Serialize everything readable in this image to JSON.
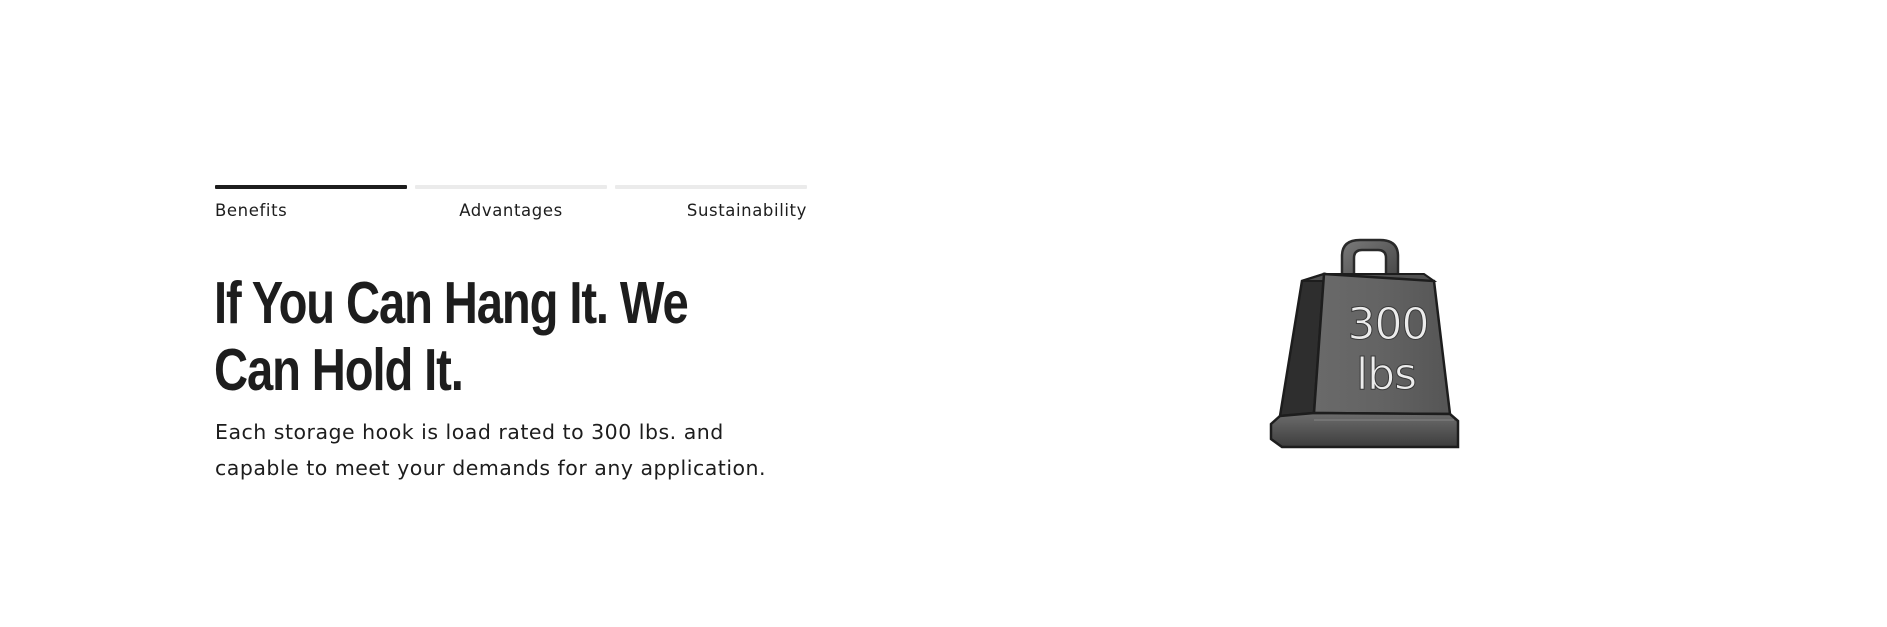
{
  "tabs": [
    {
      "label": "Benefits",
      "active": true
    },
    {
      "label": "Advantages",
      "active": false
    },
    {
      "label": "Sustainability",
      "active": false
    }
  ],
  "headline": "If You Can Hang It. We Can Hold It.",
  "description": "Each storage hook is load rated to 300 lbs. and capable to meet your demands for any application.",
  "weight_icon": {
    "icon": "kettlebell-weight-icon",
    "line1": "300",
    "line2": "lbs",
    "color": "#5a5a5a"
  }
}
